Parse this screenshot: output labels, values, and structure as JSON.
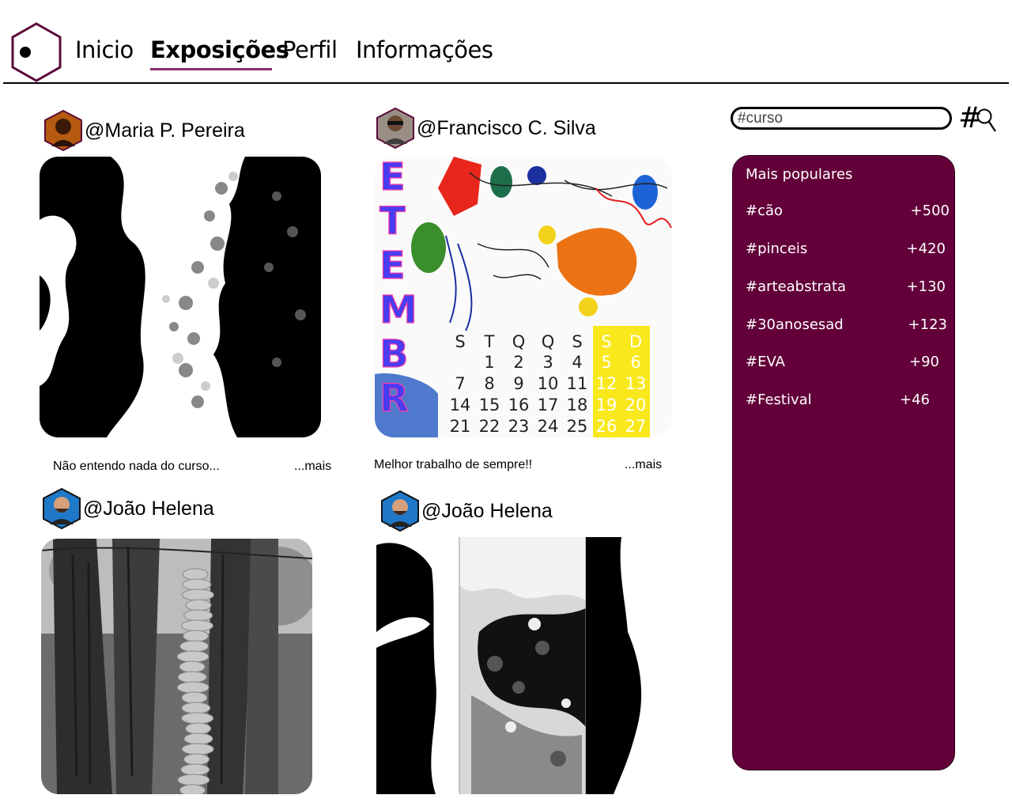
{
  "header": {
    "logo_icon": "hexagon-logo-icon",
    "nav": [
      {
        "label": "Inicio"
      },
      {
        "label": "Exposições",
        "active": true
      },
      {
        "label": "Perfil"
      },
      {
        "label": "Informações"
      }
    ]
  },
  "colors": {
    "accent": "#63003a",
    "underline": "#8b2c6e"
  },
  "posts": [
    {
      "author": "@Maria P. Pereira",
      "caption": "Não entendo nada do curso...",
      "more": "...mais"
    },
    {
      "author": "@Francisco C. Silva",
      "caption": "Melhor trabalho de sempre!!",
      "more": "...mais",
      "calendar": {
        "month_letters": [
          "E",
          "T",
          "E",
          "M",
          "B",
          "R"
        ],
        "weekdays": [
          "S",
          "T",
          "Q",
          "Q",
          "S",
          "S",
          "D"
        ],
        "weeks": [
          [
            "",
            "1",
            "2",
            "3",
            "4",
            "5",
            "6"
          ],
          [
            "7",
            "8",
            "9",
            "10",
            "11",
            "12",
            "13"
          ],
          [
            "14",
            "15",
            "16",
            "17",
            "18",
            "19",
            "20"
          ],
          [
            "21",
            "22",
            "23",
            "24",
            "25",
            "26",
            "27"
          ]
        ]
      }
    },
    {
      "author": "@João Helena"
    },
    {
      "author": "@João Helena"
    }
  ],
  "search": {
    "value": "#curso",
    "hash_symbol": "#",
    "icon": "magnifier-icon"
  },
  "trending": {
    "title": "Mais populares",
    "items": [
      {
        "tag": "#cão",
        "count": "+500"
      },
      {
        "tag": "#pinceis",
        "count": "+420"
      },
      {
        "tag": "#arteabstrata",
        "count": "+130"
      },
      {
        "tag": "#30anosesad",
        "count": "+123"
      },
      {
        "tag": "#EVA",
        "count": "+90"
      },
      {
        "tag": "#Festival",
        "count": "+46"
      }
    ]
  }
}
